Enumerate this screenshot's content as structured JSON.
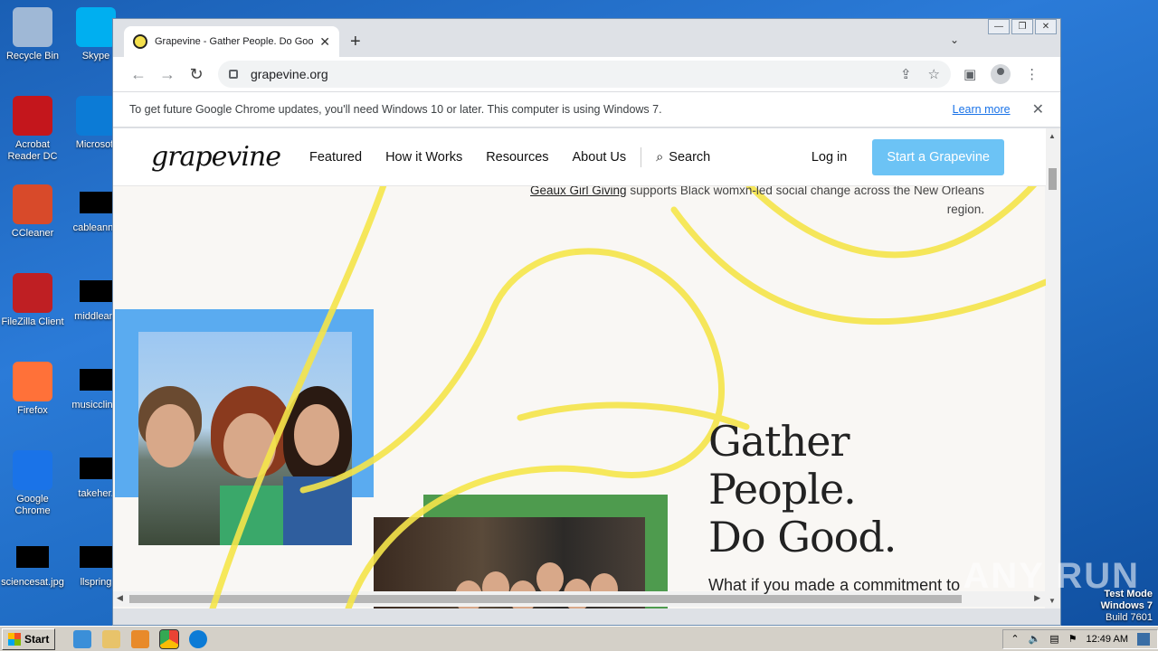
{
  "desktop": {
    "icons_left": [
      {
        "label": "Recycle Bin",
        "icon": "recycle-bin-icon",
        "color": "#9fb8d6"
      },
      {
        "label": "Acrobat Reader DC",
        "icon": "acrobat-icon",
        "color": "#c4161c"
      },
      {
        "label": "CCleaner",
        "icon": "ccleaner-icon",
        "color": "#d84a2a"
      },
      {
        "label": "FileZilla Client",
        "icon": "filezilla-icon",
        "color": "#bf1f23"
      },
      {
        "label": "Firefox",
        "icon": "firefox-icon",
        "color": "#ff7139"
      },
      {
        "label": "Google Chrome",
        "icon": "chrome-icon",
        "color": "#1a73e8"
      },
      {
        "label": "sciencesat.jpg",
        "icon": "image-file-icon",
        "color": "#000000"
      }
    ],
    "icons_right": [
      {
        "label": "Skype",
        "icon": "skype-icon",
        "color": "#00aff0"
      },
      {
        "label": "Microsoft",
        "icon": "edge-icon",
        "color": "#0c7bd6"
      },
      {
        "label": "cableannu",
        "icon": "file-icon",
        "color": "#000000"
      },
      {
        "label": "middleam",
        "icon": "file-icon",
        "color": "#000000"
      },
      {
        "label": "musicclinic",
        "icon": "file-icon",
        "color": "#000000"
      },
      {
        "label": "takeher.",
        "icon": "file-icon",
        "color": "#000000"
      },
      {
        "label": "llspring",
        "icon": "file-icon",
        "color": "#000000"
      }
    ]
  },
  "browser": {
    "tab_title": "Grapevine - Gather People. Do Good",
    "url": "grapevine.org",
    "infobar_message": "To get future Google Chrome updates, you'll need Windows 10 or later. This computer is using Windows 7.",
    "infobar_link": "Learn more"
  },
  "site": {
    "logo": "grapevine",
    "nav": [
      "Featured",
      "How it Works",
      "Resources",
      "About Us"
    ],
    "search_label": "Search",
    "login_label": "Log in",
    "cta_label": "Start a Grapevine",
    "cta_color": "#6cc3f5",
    "top_note_link": "Geaux Girl Giving",
    "top_note_text": " supports Black womxn-led social change across the New Orleans region.",
    "hero_lines": [
      "Gather",
      "People.",
      "Do Good."
    ],
    "hero_sub": "What if you made a commitment to"
  },
  "watermark": "ANY RUN",
  "taskbar": {
    "start_label": "Start",
    "clock": "12:49 AM"
  },
  "os": {
    "line1": "Test Mode",
    "line2": "Windows 7",
    "line3": "Build 7601"
  }
}
